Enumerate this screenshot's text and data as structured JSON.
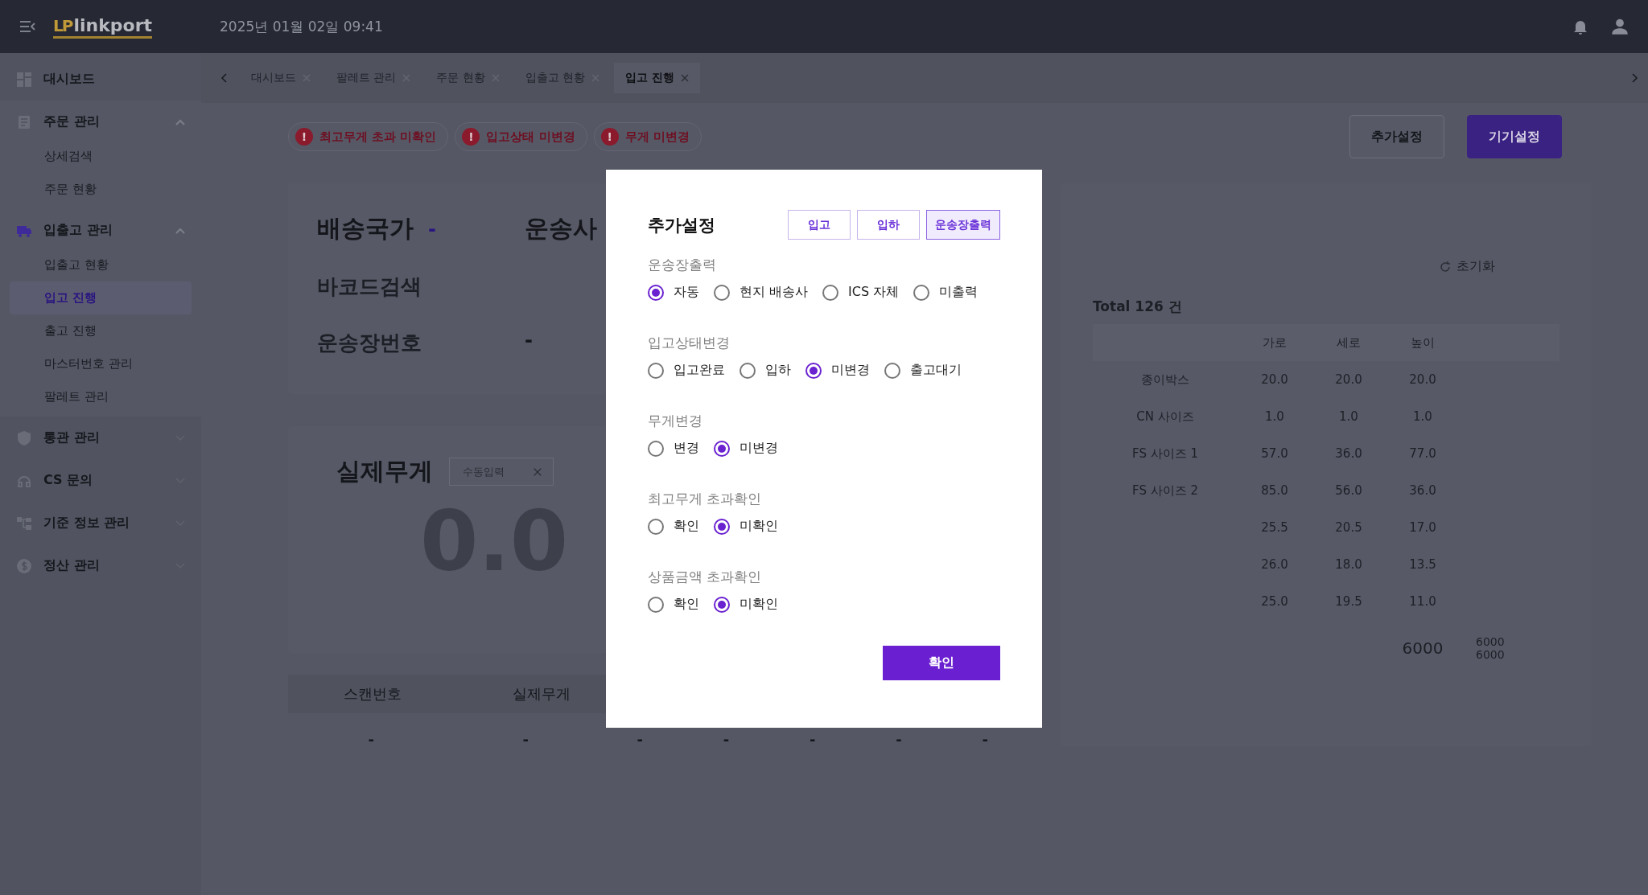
{
  "header": {
    "logo_mark": "LP",
    "logo": "linkport",
    "datetime": "2025년 01월 02일 09:41"
  },
  "sidebar": {
    "items": [
      {
        "label": "대시보드"
      },
      {
        "label": "주문 관리",
        "expanded": true,
        "children": [
          {
            "label": "상세검색",
            "selected": false
          },
          {
            "label": "주문 현황",
            "selected": false
          }
        ]
      },
      {
        "label": "입출고 관리",
        "expanded": true,
        "children": [
          {
            "label": "입출고 현황",
            "selected": false
          },
          {
            "label": "입고 진행",
            "selected": true
          },
          {
            "label": "출고 진행",
            "selected": false
          },
          {
            "label": "마스터번호 관리",
            "selected": false
          },
          {
            "label": "팔레트 관리",
            "selected": false
          }
        ]
      },
      {
        "label": "통관 관리",
        "expanded": false
      },
      {
        "label": "CS 문의",
        "expanded": false
      },
      {
        "label": "기준 정보 관리",
        "expanded": false
      },
      {
        "label": "정산 관리",
        "expanded": false
      }
    ]
  },
  "tabs": [
    {
      "label": "대시보드",
      "selected": false
    },
    {
      "label": "팔레트 관리",
      "selected": false
    },
    {
      "label": "주문 현황",
      "selected": false
    },
    {
      "label": "입출고 현황",
      "selected": false
    },
    {
      "label": "입고 진행",
      "selected": true
    }
  ],
  "alerts": [
    "최고무게 초과 미확인",
    "입고상태 미변경",
    "무게 미변경"
  ],
  "alert_mark": "!",
  "actions": [
    {
      "label": "추가설정",
      "kind": "outline"
    },
    {
      "label": "기기설정",
      "kind": "primary"
    }
  ],
  "shipment": {
    "country_label": "배송국가",
    "country_value": "-",
    "carrier_label": "운송사",
    "barcode_label": "바코드검색",
    "waybill_label": "운송장번호",
    "waybill_value": "-"
  },
  "weight": {
    "label": "실제무게",
    "placeholder": "수동입력",
    "value": "0.0"
  },
  "scan_table": {
    "columns": [
      "스캔번호",
      "실제무게"
    ],
    "row": [
      "-",
      "-",
      "-",
      "-",
      "-",
      "-",
      "-"
    ]
  },
  "volume_panel": {
    "refresh": "초기화",
    "total": "Total 126 건",
    "columns": [
      "",
      "가로",
      "세로",
      "높이"
    ],
    "rows": [
      [
        "종이박스",
        "20.0",
        "20.0",
        "20.0"
      ],
      [
        "CN 사이즈",
        "1.0",
        "1.0",
        "1.0"
      ],
      [
        "FS 사이즈 1",
        "57.0",
        "36.0",
        "77.0"
      ],
      [
        "FS 사이즈 2",
        "85.0",
        "56.0",
        "36.0"
      ],
      [
        "",
        "25.5",
        "20.5",
        "17.0"
      ],
      [
        "",
        "26.0",
        "18.0",
        "13.5"
      ],
      [
        "",
        "25.0",
        "19.5",
        "11.0"
      ]
    ],
    "footer": [
      "6000",
      "6000",
      "6000"
    ]
  },
  "modal": {
    "title": "추가설정",
    "tabs": [
      {
        "label": "입고",
        "selected": false
      },
      {
        "label": "입하",
        "selected": false
      },
      {
        "label": "운송장출력",
        "selected": true
      }
    ],
    "sections": [
      {
        "label": "운송장출력",
        "options": [
          {
            "label": "자동",
            "selected": true
          },
          {
            "label": "현지 배송사",
            "selected": false
          },
          {
            "label": "ICS 자체",
            "selected": false
          },
          {
            "label": "미출력",
            "selected": false
          }
        ]
      },
      {
        "label": "입고상태변경",
        "options": [
          {
            "label": "입고완료",
            "selected": false
          },
          {
            "label": "입하",
            "selected": false
          },
          {
            "label": "미변경",
            "selected": true
          },
          {
            "label": "출고대기",
            "selected": false
          }
        ]
      },
      {
        "label": "무게변경",
        "options": [
          {
            "label": "변경",
            "selected": false
          },
          {
            "label": "미변경",
            "selected": true
          }
        ]
      },
      {
        "label": "최고무게 초과확인",
        "options": [
          {
            "label": "확인",
            "selected": false
          },
          {
            "label": "미확인",
            "selected": true
          }
        ]
      },
      {
        "label": "상품금액 초과확인",
        "options": [
          {
            "label": "확인",
            "selected": false
          },
          {
            "label": "미확인",
            "selected": true
          }
        ]
      }
    ],
    "confirm": "확인"
  }
}
